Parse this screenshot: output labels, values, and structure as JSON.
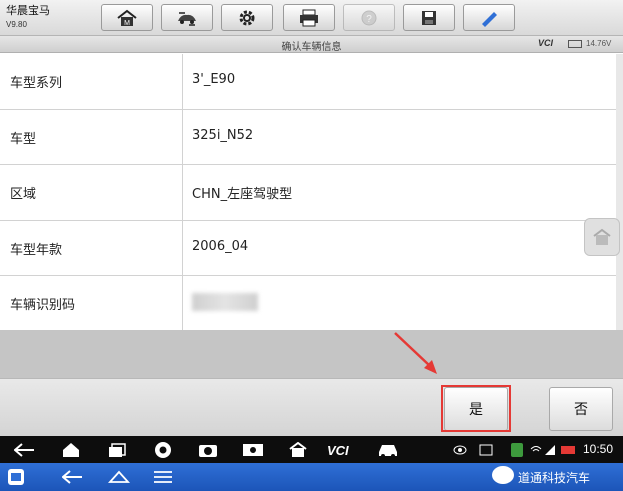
{
  "app": {
    "title": "华晨宝马",
    "version": "V9.80"
  },
  "header": {
    "title": "确认车辆信息",
    "vci_label": "VCI",
    "voltage": "14.76V"
  },
  "rows": [
    {
      "label": "车型系列",
      "value": "3'_E90"
    },
    {
      "label": "车型",
      "value": "325i_N52"
    },
    {
      "label": "区域",
      "value": "CHN_左座驾驶型"
    },
    {
      "label": "车型年款",
      "value": "2006_04"
    },
    {
      "label": "车辆识别码",
      "value": ""
    }
  ],
  "buttons": {
    "yes": "是",
    "no": "否"
  },
  "status": {
    "time": "10:50"
  },
  "watermark": "道通科技汽车",
  "colors": {
    "highlight": "#e53935",
    "host_bar": "#2f6fd6",
    "nav_bar": "#0d0d0d"
  },
  "icons": {
    "toolbar": [
      "home-icon",
      "vehicle-swap-icon",
      "settings-icon",
      "print-icon",
      "help-icon",
      "save-icon",
      "edit-icon"
    ],
    "nav": [
      "back-icon",
      "home-icon",
      "recents-icon",
      "chrome-icon",
      "camera-icon",
      "screen-record-icon",
      "maxisys-icon",
      "vci-icon",
      "car-icon"
    ]
  }
}
